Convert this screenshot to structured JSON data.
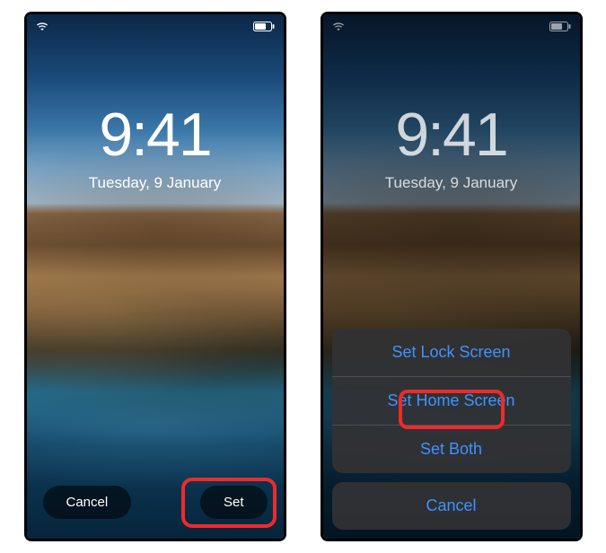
{
  "left": {
    "time": "9:41",
    "date": "Tuesday, 9 January",
    "buttons": {
      "cancel": "Cancel",
      "set": "Set"
    }
  },
  "right": {
    "time": "9:41",
    "date": "Tuesday, 9 January",
    "actions": {
      "set_lock": "Set Lock Screen",
      "set_home": "Set Home Screen",
      "set_both": "Set Both",
      "cancel": "Cancel"
    }
  }
}
